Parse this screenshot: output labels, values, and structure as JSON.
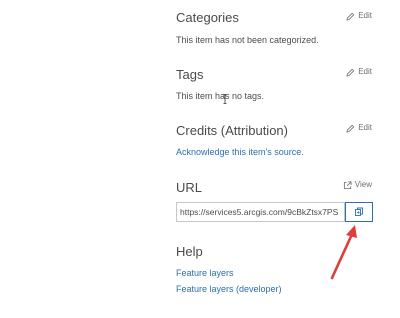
{
  "sections": {
    "categories": {
      "title": "Categories",
      "edit_label": "Edit",
      "text": "This item has not been categorized."
    },
    "tags": {
      "title": "Tags",
      "edit_label": "Edit",
      "text": "This item has no tags."
    },
    "credits": {
      "title": "Credits (Attribution)",
      "edit_label": "Edit",
      "link": "Acknowledge this item's source."
    },
    "url": {
      "title": "URL",
      "view_label": "View",
      "value": "https://services5.arcgis.com/9cBkZtsx7PS"
    },
    "help": {
      "title": "Help",
      "links": [
        "Feature layers",
        "Feature layers (developer)"
      ]
    }
  },
  "icons": {
    "edit": "pencil-icon",
    "view": "external-link-icon",
    "copy": "copy-icon",
    "arrow": "red-arrow-annotation"
  },
  "colors": {
    "link": "#2b6fae",
    "arrow": "#e03c3c",
    "text": "#4c4c4c",
    "border": "#c7c7c7"
  }
}
